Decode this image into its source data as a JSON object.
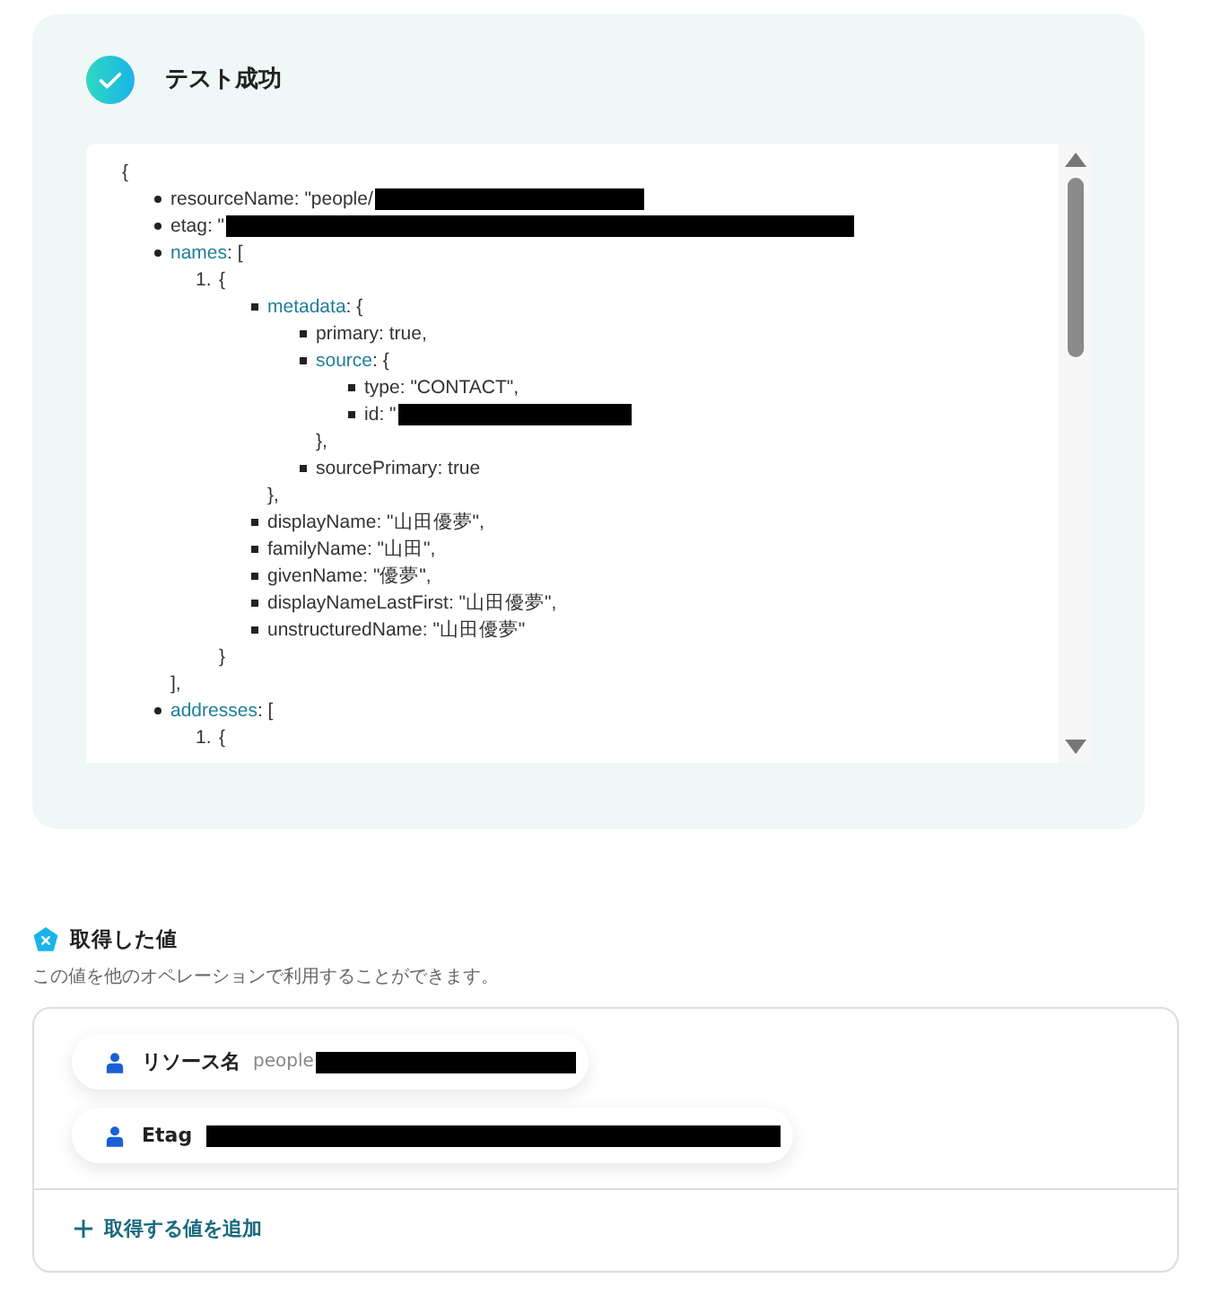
{
  "result_panel": {
    "title": "テスト成功",
    "code": {
      "open": "{",
      "items": [
        {
          "kind": "disc",
          "key": "resourceName",
          "linked": false,
          "text": ": \"people/",
          "redacted": true
        },
        {
          "kind": "disc",
          "key": "etag",
          "linked": false,
          "text": ": \"",
          "redacted": true
        },
        {
          "kind": "disc",
          "key": "names",
          "linked": true,
          "text": ": [",
          "children": [
            {
              "kind": "numbered",
              "number": "1.",
              "text": "{",
              "children": [
                {
                  "kind": "square",
                  "key": "metadata",
                  "linked": true,
                  "text": ": {",
                  "children": [
                    {
                      "kind": "square",
                      "key": "primary",
                      "linked": false,
                      "text": ": true,"
                    },
                    {
                      "kind": "square",
                      "key": "source",
                      "linked": true,
                      "text": ": {",
                      "children": [
                        {
                          "kind": "square",
                          "key": "type",
                          "linked": false,
                          "text": ": \"CONTACT\","
                        },
                        {
                          "kind": "square",
                          "key": "id",
                          "linked": false,
                          "text": ": \"",
                          "redacted": true
                        }
                      ]
                    },
                    {
                      "kind": "plain",
                      "text": "},"
                    },
                    {
                      "kind": "square",
                      "key": "sourcePrimary",
                      "linked": false,
                      "text": ": true"
                    }
                  ]
                },
                {
                  "kind": "plain",
                  "text": "},"
                },
                {
                  "kind": "square",
                  "key": "displayName",
                  "linked": false,
                  "text": ": \"山田優夢\","
                },
                {
                  "kind": "square",
                  "key": "familyName",
                  "linked": false,
                  "text": ": \"山田\","
                },
                {
                  "kind": "square",
                  "key": "givenName",
                  "linked": false,
                  "text": ": \"優夢\","
                },
                {
                  "kind": "square",
                  "key": "displayNameLastFirst",
                  "linked": false,
                  "text": ": \"山田優夢\","
                },
                {
                  "kind": "square",
                  "key": "unstructuredName",
                  "linked": false,
                  "text": ": \"山田優夢\""
                }
              ]
            },
            {
              "kind": "plain",
              "text": "}"
            }
          ]
        },
        {
          "kind": "plain",
          "text": "],"
        },
        {
          "kind": "disc",
          "key": "addresses",
          "linked": true,
          "text": ": [",
          "children": [
            {
              "kind": "numbered",
              "number": "1.",
              "text": "{"
            }
          ]
        }
      ]
    }
  },
  "fetched_values": {
    "title": "取得した値",
    "description": "この値を他のオペレーションで利用することができます。",
    "values": [
      {
        "label": "リソース名",
        "value": "people",
        "redacted": true
      },
      {
        "label": "Etag",
        "redacted": true
      }
    ],
    "add_link": "取得する値を追加"
  }
}
